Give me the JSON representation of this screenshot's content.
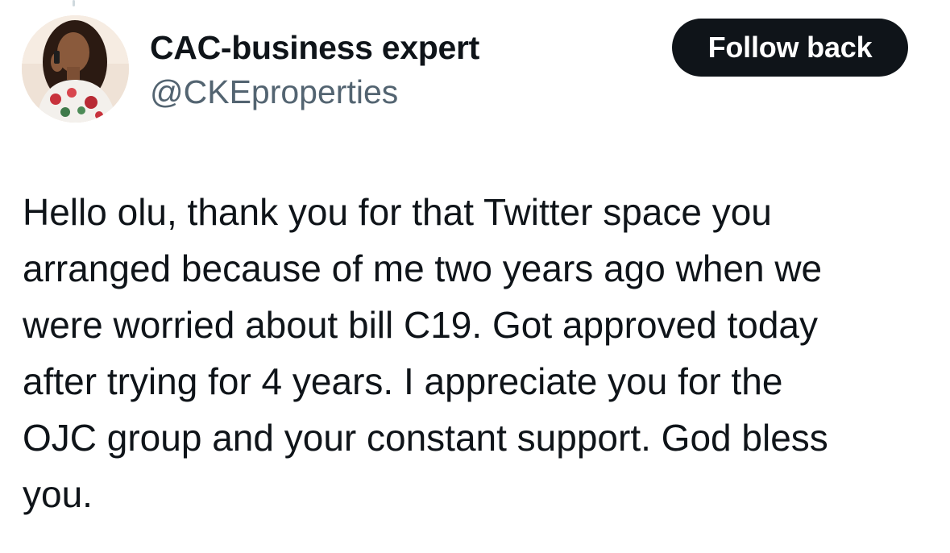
{
  "tweet": {
    "author": {
      "display_name": "CAC-business expert",
      "handle": "@CKEproperties"
    },
    "follow_button_label": "Follow back",
    "text": "Hello olu, thank you for that Twitter space you\narranged because of me two years ago when we\nwere worried about bill C19. Got approved today\nafter trying for 4 years. I appreciate you for the\nOJC group and your constant support. God bless\nyou."
  },
  "colors": {
    "text_primary": "#0f1419",
    "text_secondary": "#536471",
    "button_bg": "#0f1419",
    "button_text": "#ffffff"
  }
}
